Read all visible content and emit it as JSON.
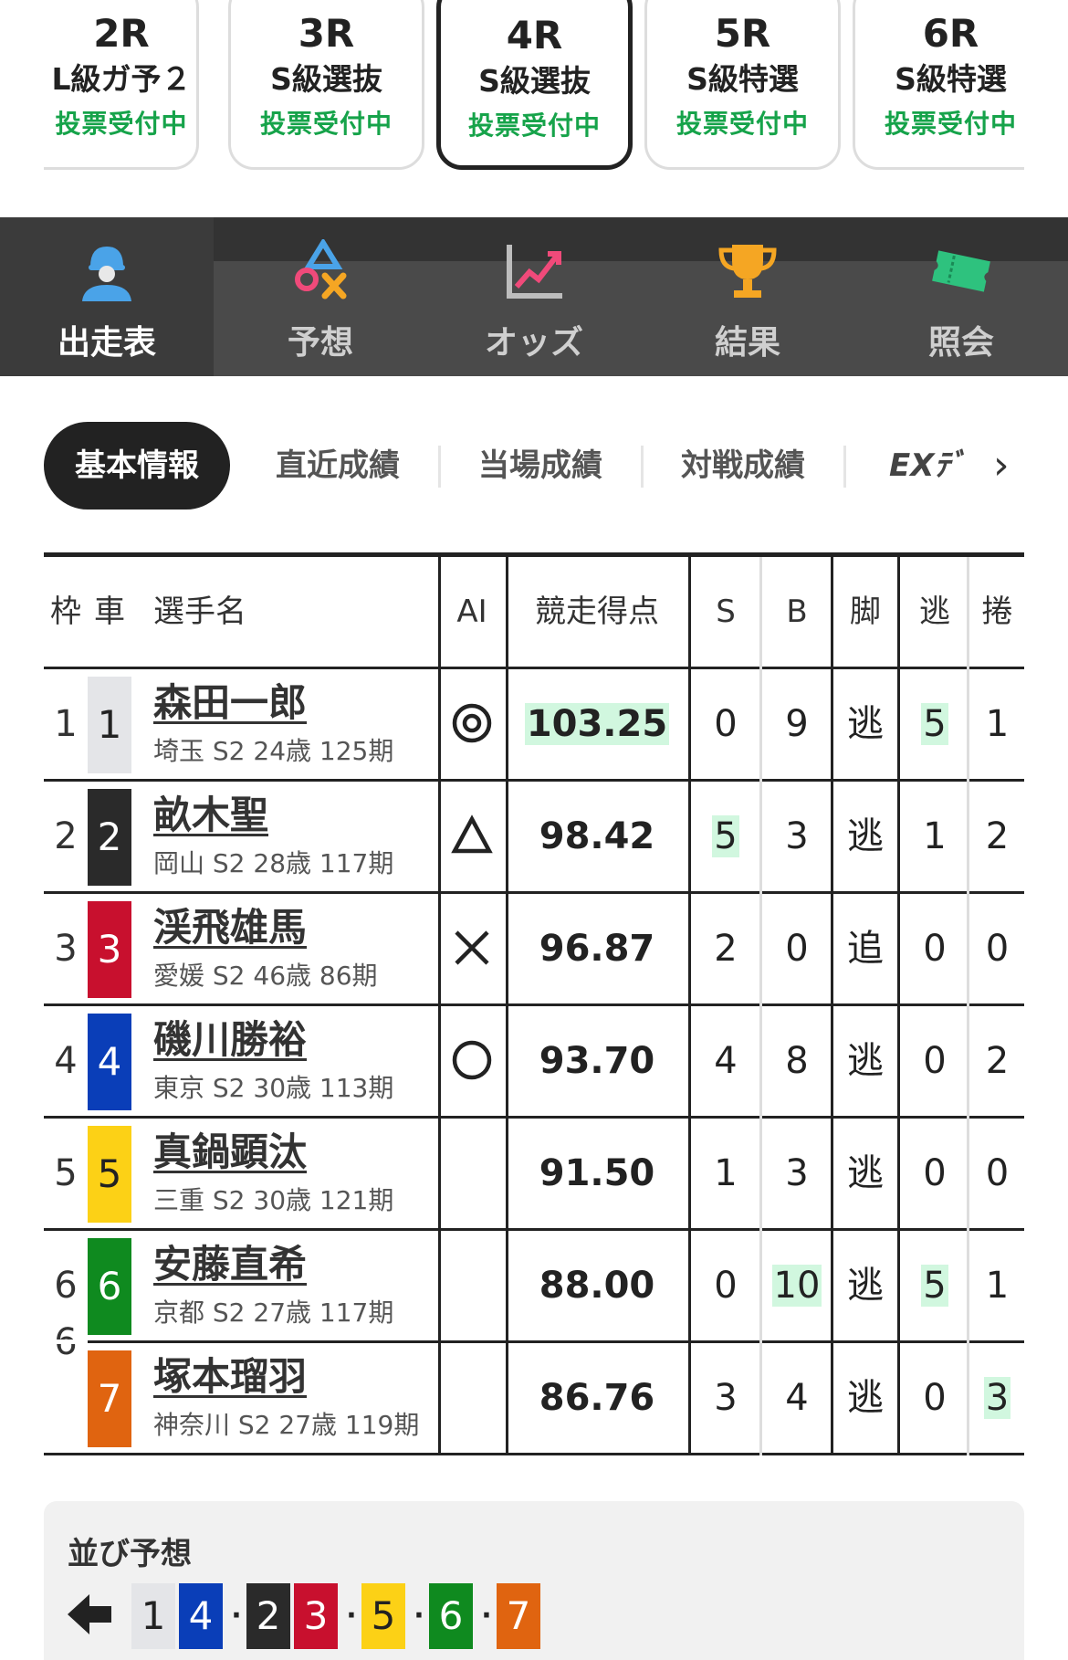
{
  "races": [
    {
      "num": "2R",
      "cls": "L級ガ予２",
      "status": "投票受付中"
    },
    {
      "num": "3R",
      "cls": "S級選抜",
      "status": "投票受付中"
    },
    {
      "num": "4R",
      "cls": "S級選抜",
      "status": "投票受付中",
      "active": true
    },
    {
      "num": "5R",
      "cls": "S級特選",
      "status": "投票受付中"
    },
    {
      "num": "6R",
      "cls": "S級特選",
      "status": "投票受付中"
    }
  ],
  "nav": [
    {
      "label": "出走表",
      "icon": "rider-icon",
      "active": true
    },
    {
      "label": "予想",
      "icon": "prediction-icon"
    },
    {
      "label": "オッズ",
      "icon": "odds-chart-icon"
    },
    {
      "label": "結果",
      "icon": "trophy-icon"
    },
    {
      "label": "照会",
      "icon": "ticket-icon"
    }
  ],
  "subtabs": [
    "基本情報",
    "直近成績",
    "当場成績",
    "対戦成績"
  ],
  "subtab_ext": "EXﾃﾞ",
  "table_headers": {
    "frame": "枠",
    "car": "車",
    "name": "選手名",
    "ai": "AI",
    "score": "競走得点",
    "s": "S",
    "b": "B",
    "leg": "脚",
    "nige": "逃",
    "makuri": "捲"
  },
  "riders": [
    {
      "frame": "1",
      "car": "1",
      "color": "#e4e5e8",
      "text_color": "#222",
      "name": "森田一郎",
      "info": "埼玉 S2 24歳 125期",
      "ai": "double-circle",
      "score": "103.25",
      "s": "0",
      "b": "9",
      "leg": "逃",
      "nige": "5",
      "makuri": "1",
      "hl": [
        "score",
        "nige"
      ]
    },
    {
      "frame": "2",
      "car": "2",
      "color": "#2a2a2a",
      "text_color": "#fff",
      "name": "畝木聖",
      "info": "岡山 S2 28歳 117期",
      "ai": "triangle",
      "score": "98.42",
      "s": "5",
      "b": "3",
      "leg": "逃",
      "nige": "1",
      "makuri": "2",
      "hl": [
        "s"
      ]
    },
    {
      "frame": "3",
      "car": "3",
      "color": "#c8102e",
      "text_color": "#fff",
      "name": "渓飛雄馬",
      "info": "愛媛 S2 46歳 86期",
      "ai": "cross",
      "score": "96.87",
      "s": "2",
      "b": "0",
      "leg": "追",
      "nige": "0",
      "makuri": "0",
      "hl": []
    },
    {
      "frame": "4",
      "car": "4",
      "color": "#0a3eb8",
      "text_color": "#fff",
      "name": "磯川勝裕",
      "info": "東京 S2 30歳 113期",
      "ai": "circle",
      "score": "93.70",
      "s": "4",
      "b": "8",
      "leg": "逃",
      "nige": "0",
      "makuri": "2",
      "hl": []
    },
    {
      "frame": "5",
      "car": "5",
      "color": "#fcd116",
      "text_color": "#222",
      "name": "真鍋顕汰",
      "info": "三重 S2 30歳 121期",
      "ai": "",
      "score": "91.50",
      "s": "1",
      "b": "3",
      "leg": "逃",
      "nige": "0",
      "makuri": "0",
      "hl": []
    },
    {
      "frame": "6",
      "car": "6",
      "color": "#0f8a1f",
      "text_color": "#fff",
      "name": "安藤直希",
      "info": "京都 S2 27歳 117期",
      "ai": "",
      "score": "88.00",
      "s": "0",
      "b": "10",
      "leg": "逃",
      "nige": "5",
      "makuri": "1",
      "hl": [
        "b",
        "nige"
      ]
    },
    {
      "frame": "",
      "car": "7",
      "color": "#e06410",
      "text_color": "#fff",
      "name": "塚本瑠羽",
      "info": "神奈川 S2 27歳 119期",
      "ai": "",
      "score": "86.76",
      "s": "3",
      "b": "4",
      "leg": "逃",
      "nige": "0",
      "makuri": "3",
      "hl": [
        "makuri"
      ]
    }
  ],
  "shared_frame": "6",
  "line_prediction": {
    "title": "並び予想",
    "chips": [
      {
        "n": "1",
        "color": "#e4e5e8",
        "tc": "#222"
      },
      {
        "n": "4",
        "color": "#0a3eb8",
        "tc": "#fff"
      },
      {
        "sep": "・"
      },
      {
        "n": "2",
        "color": "#2a2a2a",
        "tc": "#fff"
      },
      {
        "n": "3",
        "color": "#c8102e",
        "tc": "#fff"
      },
      {
        "sep": "・"
      },
      {
        "n": "5",
        "color": "#fcd116",
        "tc": "#222"
      },
      {
        "sep": "・"
      },
      {
        "n": "6",
        "color": "#0f8a1f",
        "tc": "#fff"
      },
      {
        "sep": "・"
      },
      {
        "n": "7",
        "color": "#e06410",
        "tc": "#fff"
      }
    ]
  }
}
